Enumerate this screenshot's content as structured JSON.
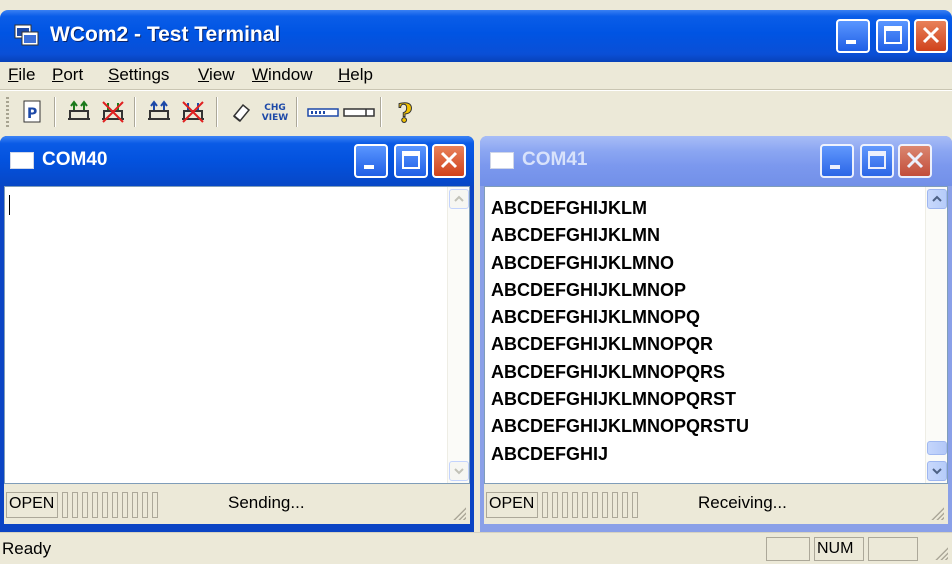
{
  "window": {
    "title": "WCom2 - Test Terminal"
  },
  "menu": [
    {
      "label": "File",
      "key": "F"
    },
    {
      "label": "Port",
      "key": "P"
    },
    {
      "label": "Settings",
      "key": "S"
    },
    {
      "label": "View",
      "key": "V"
    },
    {
      "label": "Window",
      "key": "W"
    },
    {
      "label": "Help",
      "key": "H"
    }
  ],
  "toolbar": {
    "chg_view_label_top": "CHG",
    "chg_view_label_bottom": "VIEW",
    "help_glyph": "?"
  },
  "com40": {
    "title": "COM40",
    "port_state": "OPEN",
    "activity": "Sending...",
    "lines": []
  },
  "com41": {
    "title": "COM41",
    "port_state": "OPEN",
    "activity": "Receiving...",
    "lines": [
      "ABCDEFGHIJKLM",
      "ABCDEFGHIJKLMN",
      "ABCDEFGHIJKLMNO",
      "ABCDEFGHIJKLMNOP",
      "ABCDEFGHIJKLMNOPQ",
      "ABCDEFGHIJKLMNOPQR",
      "ABCDEFGHIJKLMNOPQRS",
      "ABCDEFGHIJKLMNOPQRST",
      "ABCDEFGHIJKLMNOPQRSTU",
      "ABCDEFGHIJ"
    ]
  },
  "status": {
    "text": "Ready",
    "num_indicator": "NUM"
  },
  "colors": {
    "title_active": "#0054e3",
    "child_inactive": "#7b98ee",
    "close_button": "#d0421c"
  }
}
